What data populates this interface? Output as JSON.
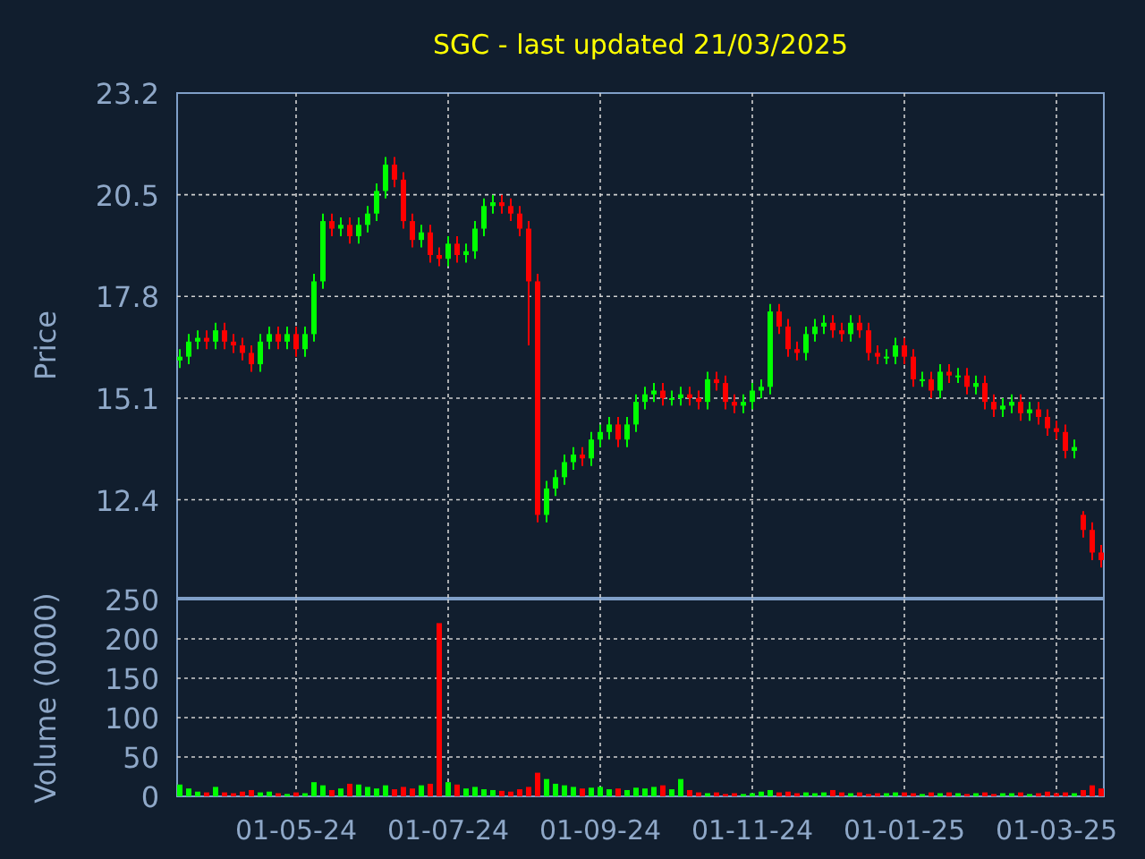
{
  "title": "SGC - last updated 21/03/2025",
  "price_chart": {
    "chart_data": {
      "type": "candlestick",
      "ylabel": "Price",
      "grid": true,
      "ylim": [
        9.8,
        23.2
      ],
      "yticks": [
        12.4,
        15.1,
        17.8,
        20.5,
        23.2
      ],
      "categories": [
        null,
        null,
        null,
        null,
        null,
        null,
        null,
        null,
        null,
        null,
        null,
        null,
        null,
        null,
        null,
        null,
        null,
        null,
        null,
        null,
        null,
        null,
        null,
        null,
        null,
        null,
        null,
        null,
        null,
        null,
        null,
        null,
        null,
        null,
        null,
        null,
        null,
        null,
        null,
        null,
        null,
        null,
        null,
        null,
        null,
        null,
        null,
        null,
        null,
        null,
        null,
        null,
        null,
        null,
        null,
        null,
        null,
        null,
        null,
        null,
        null,
        null,
        null,
        null,
        null,
        null,
        null,
        null,
        null,
        null,
        null,
        null,
        null,
        null,
        null,
        null,
        null,
        null,
        null,
        null,
        null,
        null,
        null,
        null,
        null,
        null,
        null,
        null,
        null,
        null,
        null,
        null,
        null,
        null,
        null,
        null,
        null,
        null,
        null,
        null,
        null,
        null,
        null,
        null
      ],
      "ohlc": [
        [
          16.1,
          16.4,
          15.9,
          16.2
        ],
        [
          16.2,
          16.8,
          16.0,
          16.6
        ],
        [
          16.6,
          16.9,
          16.4,
          16.7
        ],
        [
          16.7,
          16.9,
          16.4,
          16.6
        ],
        [
          16.6,
          17.1,
          16.4,
          16.9
        ],
        [
          16.9,
          17.1,
          16.4,
          16.6
        ],
        [
          16.6,
          16.8,
          16.3,
          16.5
        ],
        [
          16.5,
          16.7,
          16.1,
          16.3
        ],
        [
          16.3,
          16.5,
          15.8,
          16.0
        ],
        [
          16.0,
          16.8,
          15.8,
          16.6
        ],
        [
          16.6,
          17.0,
          16.4,
          16.8
        ],
        [
          16.8,
          17.0,
          16.4,
          16.6
        ],
        [
          16.6,
          17.0,
          16.4,
          16.8
        ],
        [
          16.8,
          17.0,
          16.2,
          16.4
        ],
        [
          16.4,
          17.0,
          16.2,
          16.8
        ],
        [
          16.8,
          18.4,
          16.6,
          18.2
        ],
        [
          18.2,
          20.0,
          18.0,
          19.8
        ],
        [
          19.8,
          20.0,
          19.4,
          19.6
        ],
        [
          19.6,
          19.9,
          19.4,
          19.7
        ],
        [
          19.7,
          19.9,
          19.2,
          19.4
        ],
        [
          19.4,
          19.9,
          19.2,
          19.7
        ],
        [
          19.7,
          20.2,
          19.5,
          20.0
        ],
        [
          20.0,
          20.8,
          19.8,
          20.6
        ],
        [
          20.6,
          21.5,
          20.4,
          21.3
        ],
        [
          21.3,
          21.5,
          20.7,
          20.9
        ],
        [
          20.9,
          21.1,
          19.6,
          19.8
        ],
        [
          19.8,
          20.0,
          19.1,
          19.3
        ],
        [
          19.3,
          19.7,
          19.1,
          19.5
        ],
        [
          19.5,
          19.7,
          18.7,
          18.9
        ],
        [
          18.9,
          19.1,
          18.6,
          18.8
        ],
        [
          18.8,
          19.4,
          18.6,
          19.2
        ],
        [
          19.2,
          19.4,
          18.7,
          18.9
        ],
        [
          18.9,
          19.2,
          18.7,
          19.0
        ],
        [
          19.0,
          19.8,
          18.8,
          19.6
        ],
        [
          19.6,
          20.4,
          19.4,
          20.2
        ],
        [
          20.2,
          20.5,
          20.0,
          20.3
        ],
        [
          20.3,
          20.5,
          20.0,
          20.2
        ],
        [
          20.2,
          20.4,
          19.8,
          20.0
        ],
        [
          20.0,
          20.2,
          19.4,
          19.6
        ],
        [
          19.6,
          19.8,
          16.5,
          18.2
        ],
        [
          18.2,
          18.4,
          11.8,
          12.0
        ],
        [
          12.0,
          12.9,
          11.8,
          12.7
        ],
        [
          12.7,
          13.2,
          12.5,
          13.0
        ],
        [
          13.0,
          13.6,
          12.8,
          13.4
        ],
        [
          13.4,
          13.8,
          13.2,
          13.6
        ],
        [
          13.6,
          13.8,
          13.3,
          13.5
        ],
        [
          13.5,
          14.2,
          13.3,
          14.0
        ],
        [
          14.0,
          14.4,
          13.8,
          14.2
        ],
        [
          14.2,
          14.6,
          14.0,
          14.4
        ],
        [
          14.4,
          14.6,
          13.8,
          14.0
        ],
        [
          14.0,
          14.6,
          13.8,
          14.4
        ],
        [
          14.4,
          15.2,
          14.2,
          15.0
        ],
        [
          15.0,
          15.4,
          14.8,
          15.2
        ],
        [
          15.2,
          15.5,
          15.0,
          15.3
        ],
        [
          15.3,
          15.5,
          14.9,
          15.1
        ],
        [
          15.1,
          15.3,
          14.9,
          15.1
        ],
        [
          15.1,
          15.4,
          14.9,
          15.2
        ],
        [
          15.2,
          15.4,
          14.9,
          15.1
        ],
        [
          15.1,
          15.3,
          14.8,
          15.0
        ],
        [
          15.0,
          15.8,
          14.8,
          15.6
        ],
        [
          15.6,
          15.8,
          15.3,
          15.5
        ],
        [
          15.5,
          15.7,
          14.8,
          15.0
        ],
        [
          15.0,
          15.2,
          14.7,
          14.9
        ],
        [
          14.9,
          15.2,
          14.7,
          15.0
        ],
        [
          15.0,
          15.5,
          14.8,
          15.3
        ],
        [
          15.3,
          15.6,
          15.1,
          15.4
        ],
        [
          15.4,
          17.6,
          15.2,
          17.4
        ],
        [
          17.4,
          17.6,
          16.8,
          17.0
        ],
        [
          17.0,
          17.2,
          16.2,
          16.4
        ],
        [
          16.4,
          16.6,
          16.1,
          16.3
        ],
        [
          16.3,
          17.0,
          16.1,
          16.8
        ],
        [
          16.8,
          17.2,
          16.6,
          17.0
        ],
        [
          17.0,
          17.3,
          16.8,
          17.1
        ],
        [
          17.1,
          17.3,
          16.7,
          16.9
        ],
        [
          16.9,
          17.1,
          16.6,
          16.8
        ],
        [
          16.8,
          17.3,
          16.6,
          17.1
        ],
        [
          17.1,
          17.3,
          16.7,
          16.9
        ],
        [
          16.9,
          17.1,
          16.1,
          16.3
        ],
        [
          16.3,
          16.5,
          16.0,
          16.2
        ],
        [
          16.2,
          16.4,
          16.0,
          16.2
        ],
        [
          16.2,
          16.7,
          16.0,
          16.5
        ],
        [
          16.5,
          16.7,
          16.0,
          16.2
        ],
        [
          16.2,
          16.4,
          15.4,
          15.6
        ],
        [
          15.6,
          15.8,
          15.4,
          15.6
        ],
        [
          15.6,
          15.8,
          15.1,
          15.3
        ],
        [
          15.3,
          16.0,
          15.1,
          15.8
        ],
        [
          15.8,
          16.0,
          15.5,
          15.7
        ],
        [
          15.7,
          15.9,
          15.5,
          15.7
        ],
        [
          15.7,
          15.9,
          15.2,
          15.4
        ],
        [
          15.4,
          15.7,
          15.2,
          15.5
        ],
        [
          15.5,
          15.7,
          14.8,
          15.0
        ],
        [
          15.0,
          15.2,
          14.6,
          14.8
        ],
        [
          14.8,
          15.1,
          14.6,
          14.9
        ],
        [
          14.9,
          15.2,
          14.7,
          15.0
        ],
        [
          15.0,
          15.2,
          14.5,
          14.7
        ],
        [
          14.7,
          15.0,
          14.5,
          14.8
        ],
        [
          14.8,
          15.0,
          14.4,
          14.6
        ],
        [
          14.6,
          14.8,
          14.1,
          14.3
        ],
        [
          14.3,
          14.5,
          14.0,
          14.2
        ],
        [
          14.2,
          14.4,
          13.5,
          13.7
        ],
        [
          13.7,
          14.0,
          13.5,
          13.8
        ],
        [
          12.0,
          12.1,
          11.4,
          11.6
        ],
        [
          11.6,
          11.8,
          10.8,
          11.0
        ],
        [
          11.0,
          11.2,
          10.6,
          10.8
        ]
      ]
    }
  },
  "volume_chart": {
    "chart_data": {
      "type": "bar",
      "ylabel": "Volume (0000)",
      "grid": true,
      "ylim": [
        0,
        250
      ],
      "yticks": [
        0,
        50,
        100,
        150,
        200,
        250
      ],
      "categories": [
        null,
        null,
        null,
        null,
        null,
        null,
        null,
        null,
        null,
        null,
        null,
        null,
        null,
        "01-05-24",
        null,
        null,
        null,
        null,
        null,
        null,
        null,
        null,
        null,
        null,
        null,
        null,
        null,
        null,
        null,
        null,
        "01-07-24",
        null,
        null,
        null,
        null,
        null,
        null,
        null,
        null,
        null,
        null,
        null,
        null,
        null,
        null,
        null,
        null,
        "01-09-24",
        null,
        null,
        null,
        null,
        null,
        null,
        null,
        null,
        null,
        null,
        null,
        null,
        null,
        null,
        null,
        null,
        "01-11-24",
        null,
        null,
        null,
        null,
        null,
        null,
        null,
        null,
        null,
        null,
        null,
        null,
        null,
        null,
        null,
        null,
        "01-01-25",
        null,
        null,
        null,
        null,
        null,
        null,
        null,
        null,
        null,
        null,
        null,
        null,
        null,
        null,
        null,
        null,
        "01-03-25",
        null,
        null,
        null,
        null,
        null
      ],
      "values": [
        15,
        10,
        6,
        5,
        12,
        5,
        4,
        6,
        8,
        5,
        6,
        4,
        3,
        5,
        4,
        18,
        14,
        8,
        10,
        16,
        15,
        12,
        10,
        14,
        9,
        12,
        10,
        14,
        16,
        220,
        18,
        15,
        10,
        12,
        9,
        8,
        7,
        6,
        9,
        12,
        30,
        22,
        16,
        14,
        12,
        10,
        11,
        12,
        9,
        10,
        8,
        11,
        10,
        12,
        14,
        9,
        22,
        8,
        5,
        4,
        5,
        3,
        4,
        3,
        4,
        6,
        8,
        5,
        6,
        4,
        5,
        4,
        5,
        8,
        5,
        4,
        5,
        3,
        4,
        4,
        5,
        5,
        4,
        3,
        5,
        4,
        5,
        4,
        3,
        4,
        5,
        3,
        4,
        4,
        5,
        3,
        4,
        6,
        4,
        5,
        4,
        8,
        14,
        10
      ]
    }
  }
}
